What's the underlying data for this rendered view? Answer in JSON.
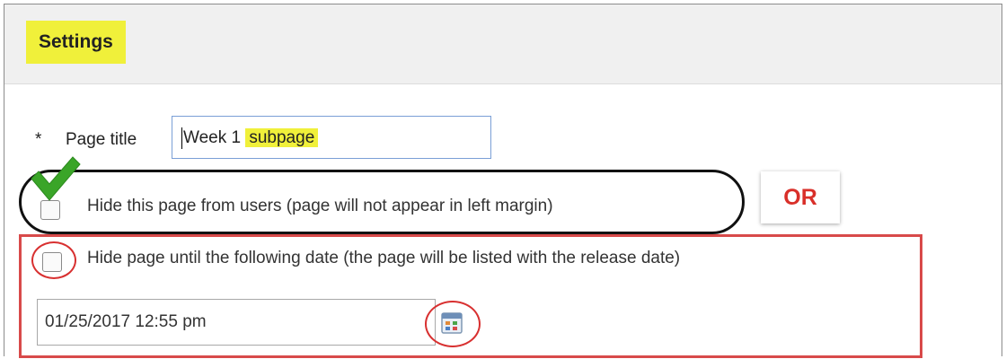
{
  "header": {
    "title": "Settings"
  },
  "form": {
    "page_title": {
      "required_marker": "*",
      "label": "Page title",
      "value_part1": "Week 1",
      "value_part2": "subpage"
    },
    "hide_page": {
      "checked": false,
      "label": "Hide this page from users (page will not appear in left margin)"
    },
    "or_label": "OR",
    "hide_until": {
      "checked": false,
      "label": "Hide page until the following date (the page will be listed with the release date)",
      "date_value": "01/25/2017 12:55 pm"
    }
  },
  "annotation_colors": {
    "highlight": "#f0f03a",
    "check_mark": "#3aa528",
    "oval": "#111111",
    "red_box": "#d84a4a"
  },
  "icons": [
    "check-icon",
    "calendar-icon"
  ]
}
